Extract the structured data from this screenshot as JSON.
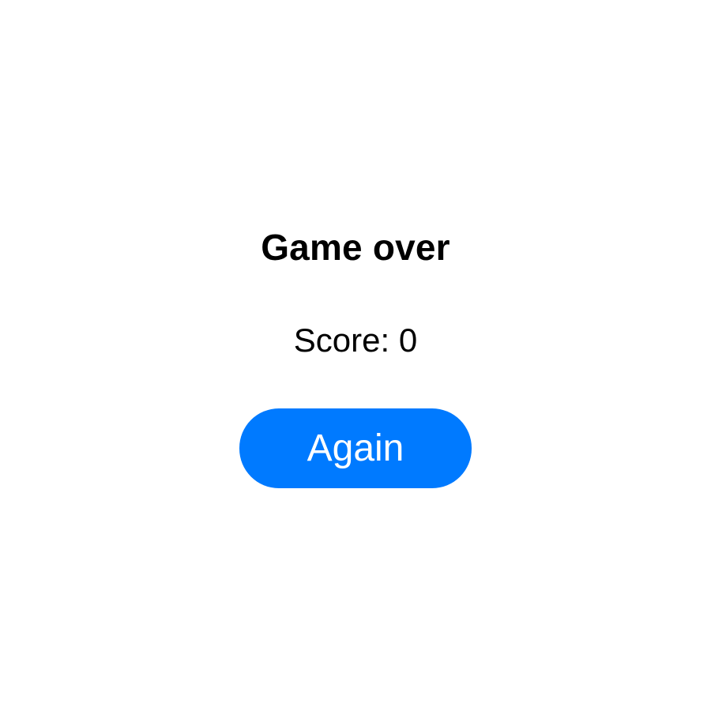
{
  "game_over": {
    "title": "Game over",
    "score_text": "Score: 0",
    "again_label": "Again"
  },
  "colors": {
    "background": "#ffffff",
    "text": "#000000",
    "button_background": "#007aff",
    "button_text": "#ffffff"
  }
}
